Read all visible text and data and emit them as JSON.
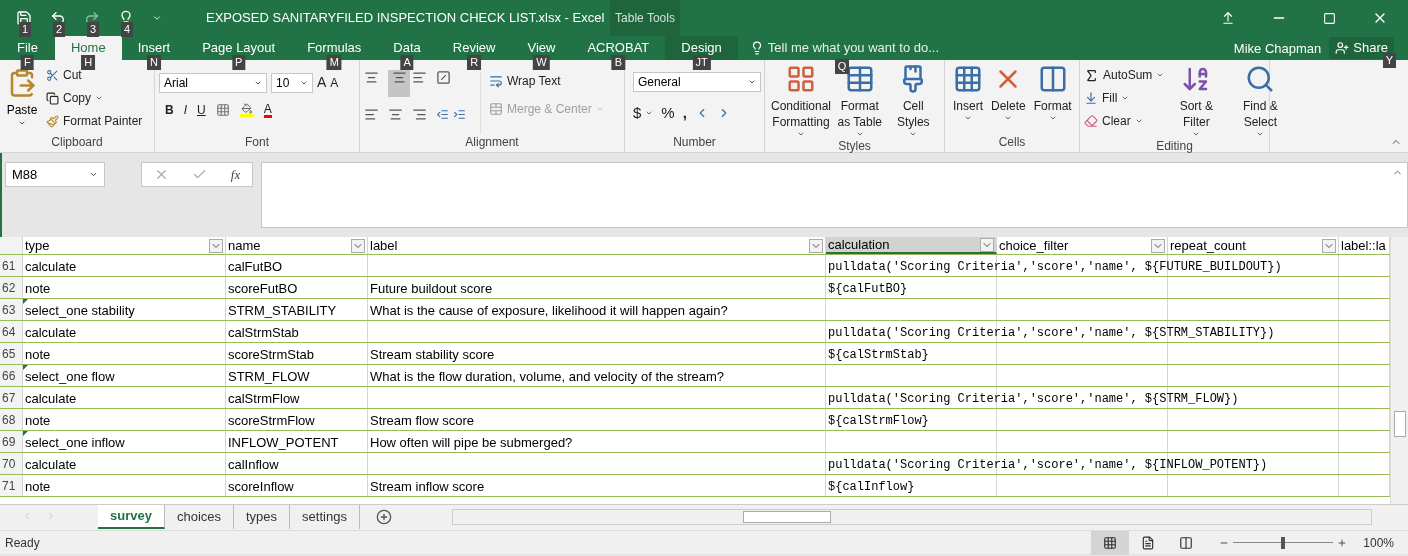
{
  "window": {
    "title": "EXPOSED SANITARYFILED INSPECTION CHECK LIST.xlsx - Excel",
    "context_group": "Table Tools",
    "user": "Mike Chapman",
    "share": "Share",
    "share_keytip": "Y"
  },
  "quick_access_keytips": [
    "1",
    "2",
    "3",
    "4"
  ],
  "tabs": [
    {
      "label": "File",
      "keytip": "F",
      "selected": false,
      "kind": "file"
    },
    {
      "label": "Home",
      "keytip": "H",
      "selected": true,
      "kind": "normal"
    },
    {
      "label": "Insert",
      "keytip": "N",
      "selected": false,
      "kind": "normal"
    },
    {
      "label": "Page Layout",
      "keytip": "P",
      "selected": false,
      "kind": "normal"
    },
    {
      "label": "Formulas",
      "keytip": "M",
      "selected": false,
      "kind": "normal"
    },
    {
      "label": "Data",
      "keytip": "A",
      "selected": false,
      "kind": "normal"
    },
    {
      "label": "Review",
      "keytip": "R",
      "selected": false,
      "kind": "normal"
    },
    {
      "label": "View",
      "keytip": "W",
      "selected": false,
      "kind": "normal"
    },
    {
      "label": "ACROBAT",
      "keytip": "B",
      "selected": false,
      "kind": "normal"
    },
    {
      "label": "Design",
      "keytip": "JT",
      "selected": false,
      "kind": "contextual"
    }
  ],
  "tell_me": {
    "text": "Tell me what you want to do...",
    "keytip": "Q"
  },
  "ribbon": {
    "clipboard": {
      "label": "Clipboard",
      "paste": "Paste",
      "cut": "Cut",
      "copy": "Copy",
      "format_painter": "Format Painter"
    },
    "font": {
      "label": "Font",
      "font_name": "Arial",
      "font_size": "10",
      "grow": "A",
      "shrink": "A",
      "bold": "B",
      "italic": "I",
      "underline": "U",
      "font_color": "A"
    },
    "alignment": {
      "label": "Alignment",
      "wrap_text": "Wrap Text",
      "merge_center": "Merge & Center",
      "merge_disabled": true
    },
    "number": {
      "label": "Number",
      "format": "General",
      "currency": "$",
      "percent": "%",
      "comma": ","
    },
    "styles": {
      "label": "Styles",
      "conditional": "Conditional Formatting",
      "format_table": "Format as Table",
      "cell_styles": "Cell Styles"
    },
    "cells": {
      "label": "Cells",
      "insert": "Insert",
      "delete": "Delete",
      "format": "Format"
    },
    "editing": {
      "label": "Editing",
      "autosum": "AutoSum",
      "fill": "Fill",
      "clear": "Clear",
      "sort": "Sort & Filter",
      "find": "Find & Select"
    }
  },
  "formula_bar": {
    "name_box": "M88",
    "fx": "fx"
  },
  "sheet": {
    "columns": [
      {
        "label": "type",
        "selected": false
      },
      {
        "label": "name",
        "selected": false
      },
      {
        "label": "label",
        "selected": false
      },
      {
        "label": "calculation",
        "selected": true
      },
      {
        "label": "choice_filter",
        "selected": false
      },
      {
        "label": "repeat_count",
        "selected": false
      },
      {
        "label": "label::la",
        "selected": false
      }
    ],
    "rows": [
      {
        "number": "61",
        "type": "calculate",
        "name": "calFutBO",
        "label": "",
        "calculation": "pulldata('Scoring Criteria','score','name', ${FUTURE_BUILDOUT})",
        "flagged": false
      },
      {
        "number": "62",
        "type": "note",
        "name": "scoreFutBO",
        "label": "Future buildout score",
        "calculation": "${calFutBO}",
        "flagged": false
      },
      {
        "number": "63",
        "type": "select_one stability",
        "name": "STRM_STABILITY",
        "label": "What is the cause of exposure, likelihood it will happen again?",
        "calculation": "",
        "flagged": true
      },
      {
        "number": "64",
        "type": "calculate",
        "name": "calStrmStab",
        "label": "",
        "calculation": "pulldata('Scoring Criteria','score','name', ${STRM_STABILITY})",
        "flagged": false
      },
      {
        "number": "65",
        "type": "note",
        "name": "scoreStrmStab",
        "label": "Stream stability score",
        "calculation": "${calStrmStab}",
        "flagged": false
      },
      {
        "number": "66",
        "type": "select_one flow",
        "name": "STRM_FLOW",
        "label": "What is the flow duration, volume, and velocity of the stream?",
        "calculation": "",
        "flagged": true
      },
      {
        "number": "67",
        "type": "calculate",
        "name": "calStrmFlow",
        "label": "",
        "calculation": "pulldata('Scoring Criteria','score','name', ${STRM_FLOW})",
        "flagged": false
      },
      {
        "number": "68",
        "type": "note",
        "name": "scoreStrmFlow",
        "label": "Stream flow score",
        "calculation": "${calStrmFlow}",
        "flagged": false
      },
      {
        "number": "69",
        "type": "select_one inflow",
        "name": "INFLOW_POTENT",
        "label": "How often will pipe be submerged?",
        "calculation": "",
        "flagged": true
      },
      {
        "number": "70",
        "type": "calculate",
        "name": "calInflow",
        "label": "",
        "calculation": "pulldata('Scoring Criteria','score','name', ${INFLOW_POTENT})",
        "flagged": false
      },
      {
        "number": "71",
        "type": "note",
        "name": "scoreInflow",
        "label": "Stream inflow score",
        "calculation": "${calInflow}",
        "flagged": false
      }
    ]
  },
  "sheet_tabs": [
    {
      "label": "survey",
      "selected": true
    },
    {
      "label": "choices",
      "selected": false
    },
    {
      "label": "types",
      "selected": false
    },
    {
      "label": "settings",
      "selected": false
    }
  ],
  "status_bar": {
    "status": "Ready",
    "zoom": "100%",
    "level": 0.5,
    "views": [
      {
        "kind": "normal",
        "selected": true
      },
      {
        "kind": "page_layout",
        "selected": false
      },
      {
        "kind": "page_break",
        "selected": false
      }
    ]
  }
}
